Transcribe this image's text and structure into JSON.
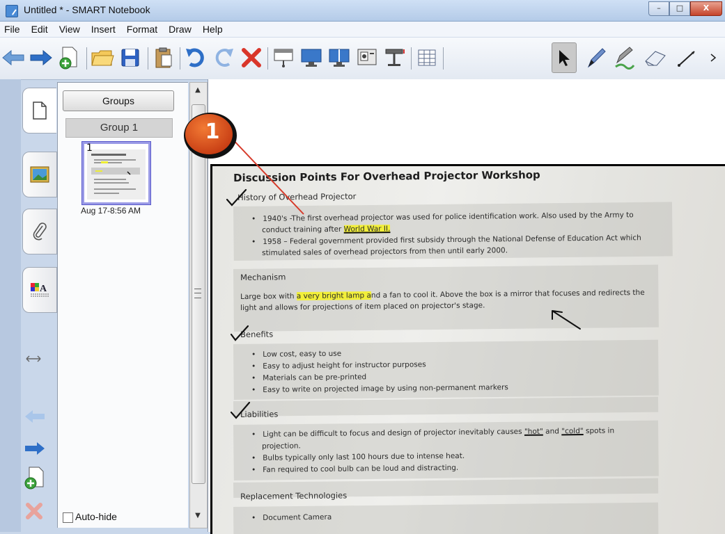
{
  "window": {
    "title": "Untitled * - SMART Notebook",
    "min_label": "–",
    "max_label": "□",
    "close_label": "X"
  },
  "menu": [
    "File",
    "Edit",
    "View",
    "Insert",
    "Format",
    "Draw",
    "Help"
  ],
  "toolbar": {
    "icons": [
      "back-arrow-icon",
      "forward-arrow-icon",
      "add-page-icon",
      "open-folder-icon",
      "save-icon",
      "paste-icon",
      "undo-icon",
      "redo-icon",
      "delete-icon",
      "screen-shade-icon",
      "full-screen-icon",
      "dual-page-icon",
      "capture-icon",
      "document-camera-icon",
      "table-icon",
      "select-arrow-icon",
      "pen-icon",
      "creative-pen-icon",
      "eraser-icon",
      "line-icon"
    ],
    "active_tool": "select-arrow-icon"
  },
  "sidebar": {
    "groups_button": "Groups",
    "group_name": "Group 1",
    "page_number": "1",
    "page_date": "Aug 17-8:56 AM",
    "autohide_label": "Auto-hide",
    "tabs": [
      "page-sorter-icon",
      "gallery-icon",
      "attachments-icon",
      "properties-icon"
    ]
  },
  "callout": {
    "number": "1"
  },
  "document": {
    "title": "Discussion Points For Overhead Projector Workshop",
    "history_heading": "History of Overhead Projector",
    "history_b1_pre": "1940's -The first overhead projector was used for police identification work. Also used by the Army to",
    "history_b1_line2_pre": "conduct training after ",
    "history_b1_hl": "World War II.",
    "history_b2_line1": "1958 – Federal government provided first subsidy through the National Defense of Education Act which",
    "history_b2_line2": "stimulated sales of overhead projectors from then until early 2000.",
    "mechanism_heading": "Mechanism",
    "mechanism_pre": "Large box with ",
    "mechanism_hl": "a very bright lamp a",
    "mechanism_post": "nd a fan to cool it. Above the box is a mirror that focuses and redirects the",
    "mechanism_line2": "light and allows for projections of item placed on projector's stage.",
    "benefits_heading": "Benefits",
    "benefits": [
      "Low cost, easy to use",
      "Easy to adjust height for instructor purposes",
      "Materials can be pre-printed",
      "Easy to write on projected image by using non-permanent markers"
    ],
    "liabilities_heading": "Liabilities",
    "liab_b1_pre": "Light can be difficult to focus and design of projector inevitably causes ",
    "liab_hot": "\"hot\"",
    "liab_and": " and ",
    "liab_cold": "\"cold\"",
    "liab_b1_post": " spots in",
    "liab_b1_line2": "projection.",
    "liab_b2": "Bulbs typically only last 100 hours due to intense heat.",
    "liab_b3": "Fan required to cool bulb can be loud and distracting.",
    "replacement_heading": "Replacement Technologies",
    "replacement_b1": "Document Camera"
  }
}
